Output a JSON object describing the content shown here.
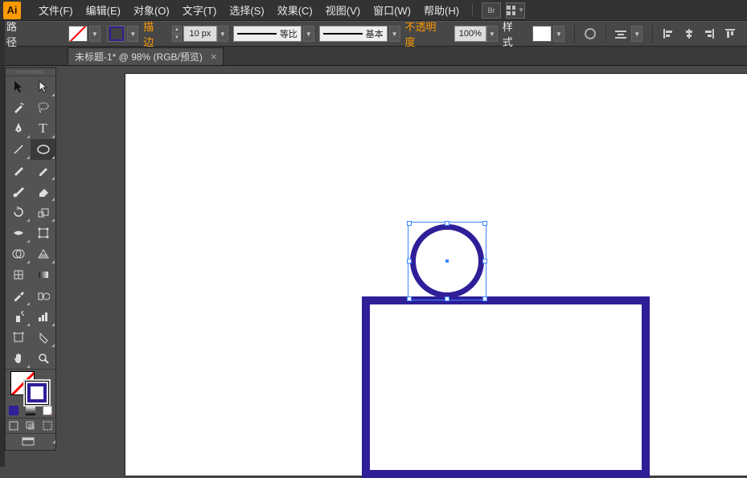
{
  "app": {
    "logo_text": "Ai"
  },
  "menu": {
    "file": "文件(F)",
    "edit": "编辑(E)",
    "object": "对象(O)",
    "type": "文字(T)",
    "select": "选择(S)",
    "effect": "效果(C)",
    "view": "视图(V)",
    "window": "窗口(W)",
    "help": "帮助(H)"
  },
  "toolbar_icons": {
    "br": "Br"
  },
  "options": {
    "selection_label": "路径",
    "stroke_label": "描边",
    "stroke_width": "10 px",
    "profile_prefix": "等比",
    "brush_prefix": "基本",
    "opacity_label": "不透明度",
    "opacity_value": "100%",
    "style_label": "样式"
  },
  "tab": {
    "title": "未标题-1* @ 98% (RGB/预览)",
    "close": "×"
  },
  "shapes": {
    "rect_color": "#2e1f99",
    "circle_color": "#2e1f99"
  }
}
